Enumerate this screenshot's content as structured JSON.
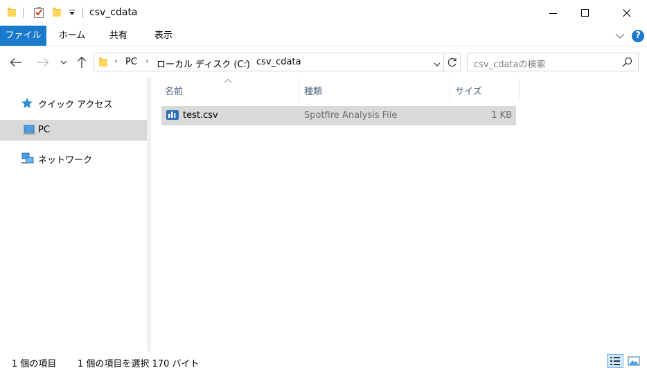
{
  "window": {
    "title": "csv_cdata",
    "minimize_icon": "minimize-icon",
    "maximize_icon": "maximize-icon",
    "close_icon": "close-icon"
  },
  "ribbon": {
    "tabs": [
      {
        "label": "ファイル",
        "active": true
      },
      {
        "label": "ホーム",
        "active": false
      },
      {
        "label": "共有",
        "active": false
      },
      {
        "label": "表示",
        "active": false
      }
    ],
    "help_label": "?"
  },
  "address": {
    "path": [
      "PC",
      "ローカル ディスク (C:)",
      "csv_cdata"
    ]
  },
  "search": {
    "placeholder": "csv_cdataの検索"
  },
  "nav": {
    "items": [
      {
        "label": "クイック アクセス",
        "icon": "quick-access-star-icon"
      },
      {
        "label": "PC",
        "icon": "pc-icon"
      },
      {
        "label": "ネットワーク",
        "icon": "network-icon"
      }
    ]
  },
  "columns": {
    "name": "名前",
    "type": "種類",
    "size": "サイズ"
  },
  "files": [
    {
      "name": "test.csv",
      "type": "Spotfire Analysis File",
      "size": "1 KB",
      "icon": "spotfire-file-icon"
    }
  ],
  "status": {
    "count": "1 個の項目",
    "selected": "1 個の項目を選択  170 バイト"
  },
  "colors": {
    "accent": "#1979ca",
    "selection": "#d9d9d9",
    "header_text": "#4c607a"
  }
}
